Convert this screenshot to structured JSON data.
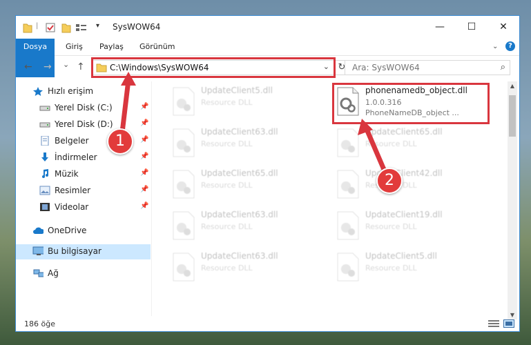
{
  "window": {
    "title": "SysWOW64",
    "controls": {
      "minimize": "—",
      "maximize": "☐",
      "close": "✕"
    }
  },
  "ribbon": {
    "tabs": [
      "Dosya",
      "Giriş",
      "Paylaş",
      "Görünüm"
    ],
    "help": "?"
  },
  "nav": {
    "back": "←",
    "forward": "→",
    "recent": "⌄",
    "up": "↑",
    "address": "C:\\Windows\\SysWOW64",
    "refresh": "↻",
    "search_placeholder": "Ara: SysWOW64"
  },
  "sidebar": {
    "items": [
      {
        "label": "Hızlı erişim",
        "icon": "star-icon",
        "pinned": false
      },
      {
        "label": "Yerel Disk (C:)",
        "icon": "drive-icon",
        "pinned": true
      },
      {
        "label": "Yerel Disk (D:)",
        "icon": "drive-icon",
        "pinned": true
      },
      {
        "label": "Belgeler",
        "icon": "documents-icon",
        "pinned": true
      },
      {
        "label": "İndirmeler",
        "icon": "download-icon",
        "pinned": true
      },
      {
        "label": "Müzik",
        "icon": "music-icon",
        "pinned": true
      },
      {
        "label": "Resimler",
        "icon": "pictures-icon",
        "pinned": true
      },
      {
        "label": "Videolar",
        "icon": "videos-icon",
        "pinned": true
      },
      {
        "label": "OneDrive",
        "icon": "cloud-icon",
        "pinned": false
      },
      {
        "label": "Bu bilgisayar",
        "icon": "computer-icon",
        "pinned": false,
        "selected": true
      },
      {
        "label": "Ağ",
        "icon": "network-icon",
        "pinned": false
      }
    ]
  },
  "files": {
    "highlighted": {
      "name": "phonenamedb_object.dll",
      "version": "1.0.0.316",
      "description": "PhoneNameDB_object ..."
    },
    "left_column": [
      {
        "name": "UpdateClient5.dll",
        "description": "Resource DLL"
      },
      {
        "name": "UpdateClient63.dll",
        "description": "Resource DLL"
      },
      {
        "name": "UpdateClient65.dll",
        "description": "Resource DLL"
      },
      {
        "name": "UpdateClient63.dll",
        "description": "Resource DLL"
      },
      {
        "name": "UpdateClient63.dll",
        "description": "Resource DLL"
      }
    ],
    "right_column": [
      {
        "name": "UpdateClient65.dll",
        "description": "Resource DLL"
      },
      {
        "name": "UpdateClient42.dll",
        "description": "Resource DLL"
      },
      {
        "name": "UpdateClient19.dll",
        "description": "Resource DLL"
      },
      {
        "name": "UpdateClient5.dll",
        "description": "Resource DLL"
      }
    ]
  },
  "status": {
    "count": "186 öğe"
  },
  "annotations": {
    "callout1": "1",
    "callout2": "2",
    "highlight_color": "#d9363e"
  }
}
